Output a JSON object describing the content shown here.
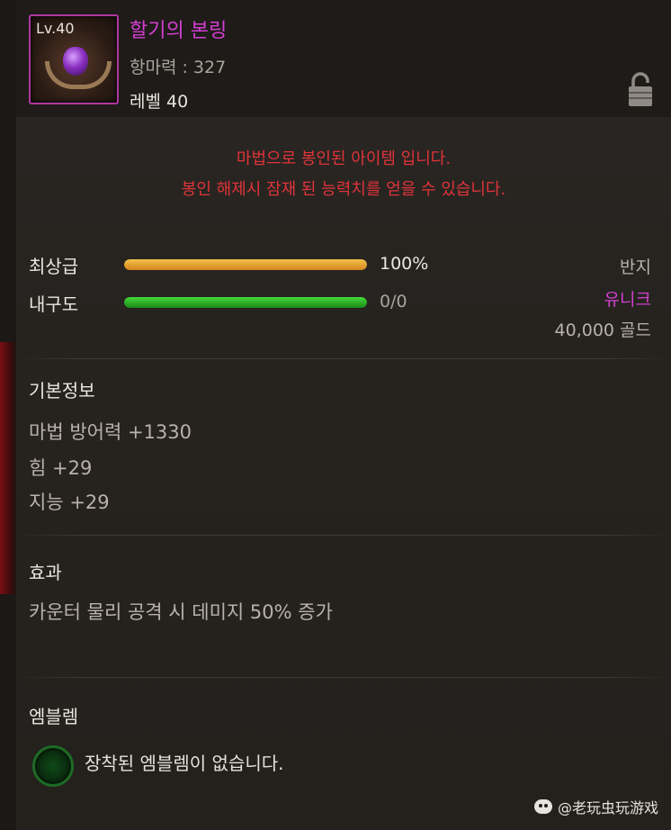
{
  "item": {
    "level_badge": "Lv.40",
    "name": "할기의 본링",
    "magic_resist": "항마력 : 327",
    "level": "레벨 40",
    "icon": "ring-item-icon",
    "lock_icon": "padlock-icon"
  },
  "seal_message": {
    "line1": "마법으로 봉인된 아이템 입니다.",
    "line2": "봉인 해제시 잠재 된 능력치를 얻을 수 있습니다."
  },
  "quality": {
    "label": "최상급",
    "value": "100%",
    "fraction": 1.0
  },
  "durability": {
    "label": "내구도",
    "value": "0/0",
    "fraction": 1.0
  },
  "meta": {
    "type": "반지",
    "rarity": "유니크",
    "price": "40,000 골드"
  },
  "basic_info": {
    "title": "기본정보",
    "lines": [
      "마법 방어력 +1330",
      "힘 +29",
      "지능 +29"
    ]
  },
  "effect": {
    "title": "효과",
    "line": "카운터 물리 공격 시 데미지 50% 증가"
  },
  "emblem": {
    "title": "엠블렘",
    "empty_text": "장착된 엠블렘이 없습니다."
  },
  "watermark": {
    "text": "@老玩虫玩游戏"
  },
  "colors": {
    "item_name": "#d43fd0",
    "seal_text": "#e0343a",
    "rarity": "#d43fd0",
    "quality_bar": "#f2c24a",
    "durability_bar": "#44d83a"
  }
}
